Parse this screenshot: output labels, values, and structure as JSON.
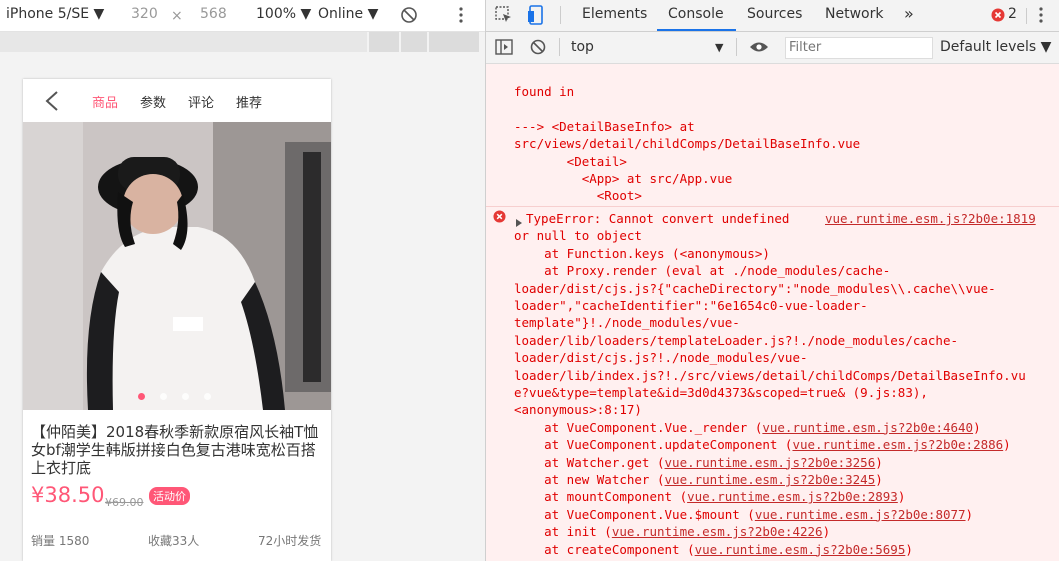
{
  "device_toolbar": {
    "device": "iPhone 5/SE ▼",
    "width": "320",
    "times": "×",
    "height": "568",
    "zoom": "100% ▼",
    "network": "Online ▼"
  },
  "phone": {
    "nav_tabs": [
      "商品",
      "参数",
      "评论",
      "推荐"
    ],
    "active_tab": "商品",
    "title": "【仲陌美】2018春秋季新款原宿风长袖T恤女bf潮学生韩版拼接白色复古港味宽松百搭上衣打底",
    "price": "¥38.50",
    "old_price": "¥69.00",
    "promo": "活动价",
    "stats": [
      "销量 1580",
      "收藏33人",
      "72小时发货"
    ],
    "colors": {
      "accent": "#ff5777"
    }
  },
  "devtools": {
    "tabs": [
      "Elements",
      "Console",
      "Sources",
      "Network",
      "»"
    ],
    "active_tab": "Console",
    "error_count": "2",
    "context": "top",
    "filter_placeholder": "Filter",
    "levels": "Default levels ▼"
  },
  "console": {
    "found_in": [
      "found in",
      "",
      "---> <DetailBaseInfo> at",
      "src/views/detail/childComps/DetailBaseInfo.vue",
      "       <Detail>",
      "         <App> at src/App.vue",
      "           <Root>"
    ],
    "error": {
      "message_l1": "TypeError: Cannot convert undefined",
      "source": "vue.runtime.esm.js?2b0e:1819",
      "lines": [
        "or null to object",
        "    at Function.keys (<anonymous>)",
        "    at Proxy.render (eval at ./node_modules/cache-",
        "loader/dist/cjs.js?{\"cacheDirectory\":\"node_modules\\\\.cache\\\\vue-",
        "loader\",\"cacheIdentifier\":\"6e1654c0-vue-loader-",
        "template\"}!./node_modules/vue-",
        "loader/lib/loaders/templateLoader.js?!./node_modules/cache-",
        "loader/dist/cjs.js?!./node_modules/vue-",
        "loader/lib/index.js?!./src/views/detail/childComps/DetailBaseInfo.vu",
        "e?vue&type=template&id=3d0d4373&scoped=true& (9.js:83),",
        "<anonymous>:8:17)"
      ],
      "stack": [
        {
          "fn": "    at VueComponent.Vue._render (",
          "link": "vue.runtime.esm.js?2b0e:4640",
          "end": ")"
        },
        {
          "fn": "    at VueComponent.updateComponent (",
          "link": "vue.runtime.esm.js?2b0e:2886",
          "end": ")"
        },
        {
          "fn": "    at Watcher.get (",
          "link": "vue.runtime.esm.js?2b0e:3256",
          "end": ")"
        },
        {
          "fn": "    at new Watcher (",
          "link": "vue.runtime.esm.js?2b0e:3245",
          "end": ")"
        },
        {
          "fn": "    at mountComponent (",
          "link": "vue.runtime.esm.js?2b0e:2893",
          "end": ")"
        },
        {
          "fn": "    at VueComponent.Vue.$mount (",
          "link": "vue.runtime.esm.js?2b0e:8077",
          "end": ")"
        },
        {
          "fn": "    at init (",
          "link": "vue.runtime.esm.js?2b0e:4226",
          "end": ")"
        },
        {
          "fn": "    at createComponent (",
          "link": "vue.runtime.esm.js?2b0e:5695",
          "end": ")"
        }
      ]
    }
  }
}
